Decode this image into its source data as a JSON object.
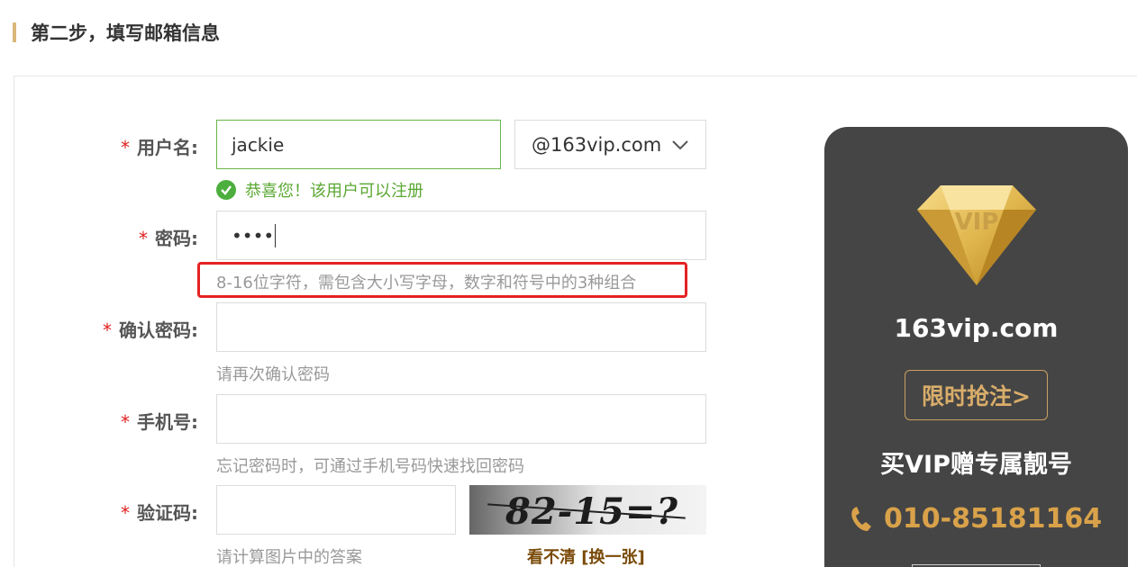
{
  "header": {
    "title": "第二步，填写邮箱信息"
  },
  "form": {
    "required_mark": "*",
    "username": {
      "label": "用户名:",
      "value": "jackie",
      "domain": "@163vip.com",
      "success_message": "恭喜您！该用户可以注册"
    },
    "password": {
      "label": "密码:",
      "value": "••••",
      "hint": "8-16位字符，需包含大小写字母，数字和符号中的3种组合"
    },
    "confirm_password": {
      "label": "确认密码:",
      "value": "",
      "hint": "请再次确认密码"
    },
    "phone": {
      "label": "手机号:",
      "value": "",
      "hint": "忘记密码时，可通过手机号码快速找回密码"
    },
    "captcha": {
      "label": "验证码:",
      "value": "",
      "hint": "请计算图片中的答案",
      "image_text": "82-15=?",
      "refresh_label": "看不清 [换一张]"
    }
  },
  "promo": {
    "badge_text": "VIP",
    "domain": "163vip.com",
    "button_label": "限时抢注>",
    "slogan": "买VIP赠专属靓号",
    "phone": "010-85181164"
  },
  "colors": {
    "accent_gold": "#d9ad6a",
    "success_green": "#5aa832",
    "required_red": "#e02020",
    "highlight_red": "#e52222",
    "promo_bg": "#454545"
  }
}
